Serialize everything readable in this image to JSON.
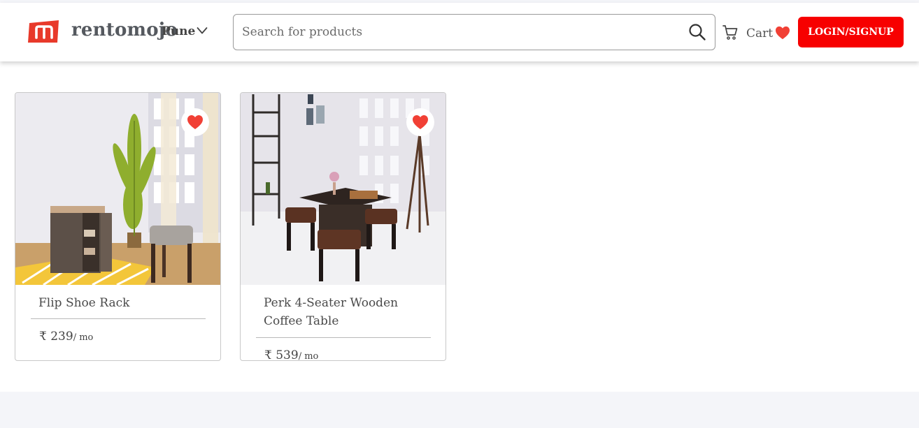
{
  "header": {
    "brand": "rentomojo",
    "city": "Pune",
    "search_placeholder": "Search for products",
    "cart_label": "Cart",
    "login_label": "LOGIN/SIGNUP"
  },
  "icons": {
    "logo": "rentomojo-logo-icon",
    "city_dropdown": "chevron-down-icon",
    "search": "search-icon",
    "cart": "cart-icon",
    "wishlist": "heart-icon"
  },
  "colors": {
    "brand_red": "#f70000",
    "heart": "#f14035",
    "footer_band": "#f4f5f9"
  },
  "products": [
    {
      "title": "Flip Shoe Rack",
      "currency": "₹",
      "price": "239",
      "per": "/ mo"
    },
    {
      "title": "Perk 4-Seater Wooden Coffee Table",
      "currency": "₹",
      "price": "539",
      "per": "/ mo"
    }
  ]
}
